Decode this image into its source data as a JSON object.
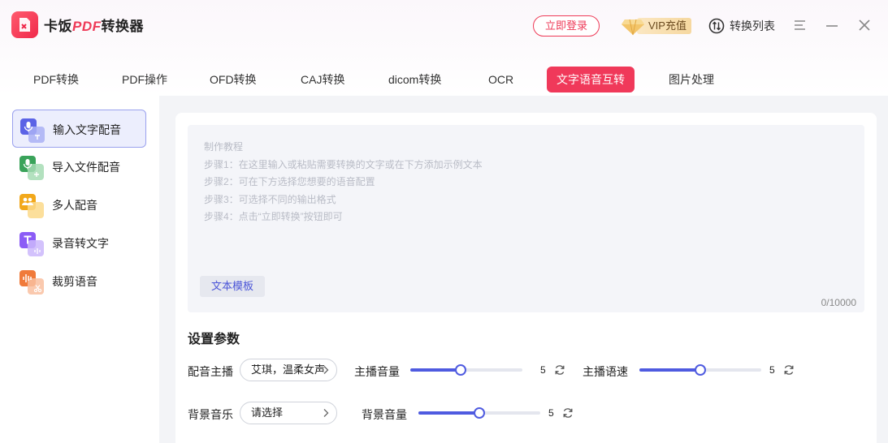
{
  "app": {
    "title_prefix": "卡饭",
    "title_pdf": "PDF",
    "title_suffix": "转换器",
    "login_label": "立即登录",
    "vip_label": "VIP充值",
    "conv_list_label": "转换列表"
  },
  "tabs": [
    {
      "label": "PDF转换",
      "active": false
    },
    {
      "label": "PDF操作",
      "active": false
    },
    {
      "label": "OFD转换",
      "active": false
    },
    {
      "label": "CAJ转换",
      "active": false
    },
    {
      "label": "dicom转换",
      "active": false
    },
    {
      "label": "OCR",
      "active": false
    },
    {
      "label": "文字语音互转",
      "active": true
    },
    {
      "label": "图片处理",
      "active": false
    }
  ],
  "sidebar": {
    "items": [
      {
        "label": "输入文字配音",
        "icon": "mic-text-icon",
        "color": "#5b63e6",
        "active": true
      },
      {
        "label": "导入文件配音",
        "icon": "mic-add-icon",
        "color": "#3aa35a",
        "active": false
      },
      {
        "label": "多人配音",
        "icon": "people-icon",
        "color": "#f2a81b",
        "active": false
      },
      {
        "label": "录音转文字",
        "icon": "text-audio-icon",
        "color": "#8b5cf6",
        "active": false
      },
      {
        "label": "裁剪语音",
        "icon": "audio-cut-icon",
        "color": "#f07a3a",
        "active": false
      }
    ]
  },
  "editor": {
    "tutorial_title": "制作教程",
    "steps": [
      "步骤1：在这里输入或粘贴需要转换的文字或在下方添加示例文本",
      "步骤2：可在下方选择您想要的语音配置",
      "步骤3：可选择不同的输出格式",
      "步骤4：点击“立即转换”按钮即可"
    ],
    "template_label": "文本模板",
    "counter": "0/10000"
  },
  "settings": {
    "title": "设置参数",
    "voice_label": "配音主播",
    "voice_value": "艾琪，温柔女声",
    "anchor_volume_label": "主播音量",
    "anchor_volume_value": "5",
    "anchor_volume_level": 0.45,
    "anchor_speed_label": "主播语速",
    "anchor_speed_value": "5",
    "anchor_speed_level": 0.5,
    "bgm_label": "背景音乐",
    "bgm_value": "请选择",
    "bgm_volume_label": "背景音量",
    "bgm_volume_value": "5",
    "bgm_volume_level": 0.5
  },
  "colors": {
    "accent": "#f0395a",
    "slider": "#4f5be0"
  }
}
